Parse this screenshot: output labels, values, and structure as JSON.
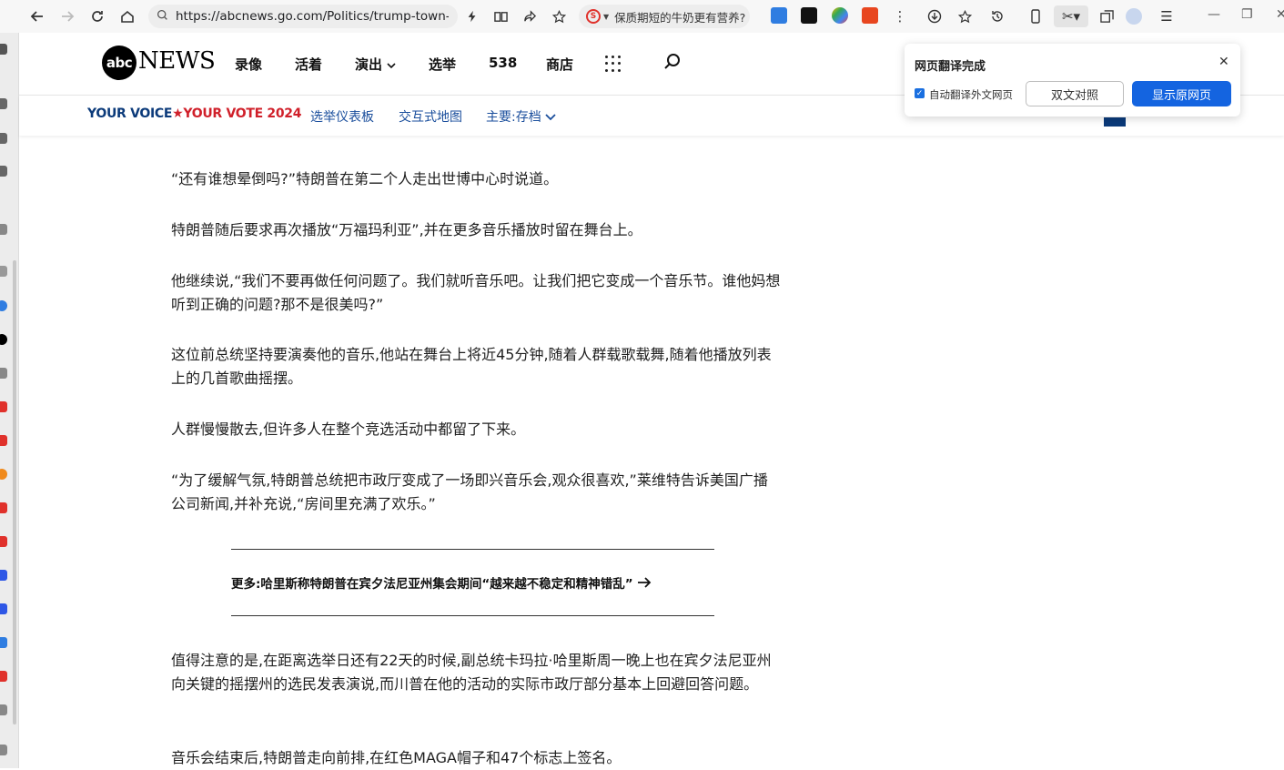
{
  "browser": {
    "url": "https://abcnews.go.com/Politics/trump-town-",
    "search_suggestion": "保质期短的牛奶更有营养?",
    "search_engine_glyph": "S",
    "icons": [
      "back-icon",
      "forward-icon",
      "reload-icon",
      "home-icon",
      "lock-icon",
      "lightning-icon",
      "reader-icon",
      "share-icon",
      "star-icon",
      "menu-icon"
    ]
  },
  "site": {
    "logo_abc": "abc",
    "logo_news": "NEWS",
    "nav": [
      "录像",
      "活着",
      "演出",
      "选举",
      "538",
      "商店"
    ],
    "subnav": {
      "logo_left": "YOUR VOICE",
      "logo_right": "YOUR VOTE 2024",
      "links": [
        "选举仪表板",
        "交互式地图",
        "主要:存档"
      ]
    }
  },
  "article": {
    "paragraphs": [
      "“还有谁想晕倒吗?”特朗普在第二个人走出世博中心时说道。",
      "特朗普随后要求再次播放“万福玛利亚”,并在更多音乐播放时留在舞台上。",
      "他继续说,“我们不要再做任何问题了。我们就听音乐吧。让我们把它变成一个音乐节。谁他妈想听到正确的问题?那不是很美吗?”",
      "这位前总统坚持要演奏他的音乐,他站在舞台上将近45分钟,随着人群载歌载舞,随着他播放列表上的几首歌曲摇摆。",
      "人群慢慢散去,但许多人在整个竞选活动中都留了下来。",
      "“为了缓解气氛,特朗普总统把市政厅变成了一场即兴音乐会,观众很喜欢,”莱维特告诉美国广播公司新闻,并补充说,“房间里充满了欢乐。”"
    ],
    "more": "更多:哈里斯称特朗普在宾夕法尼亚州集会期间“越来越不稳定和精神错乱”",
    "paragraphs_after": [
      "值得注意的是,在距离选举日还有22天的时候,副总统卡玛拉·哈里斯周一晚上也在宾夕法尼亚州向关键的摇摆州的选民发表演说,而川普在他的活动的实际市政厅部分基本上回避回答问题。",
      "音乐会结束后,特朗普走向前排,在红色MAGA帽子和47个标志上签名。"
    ]
  },
  "translate_popup": {
    "title": "网页翻译完成",
    "auto_translate_label": "自动翻译外文网页",
    "auto_translate_checked": true,
    "bilingual_button": "双文对照",
    "show_original_button": "显示原网页"
  },
  "colors": {
    "accent_blue": "#1464e0",
    "abc_black": "#000000",
    "vote_navy": "#0b3a7a",
    "vote_red": "#d0202a",
    "link_blue": "#1a4e9c"
  }
}
